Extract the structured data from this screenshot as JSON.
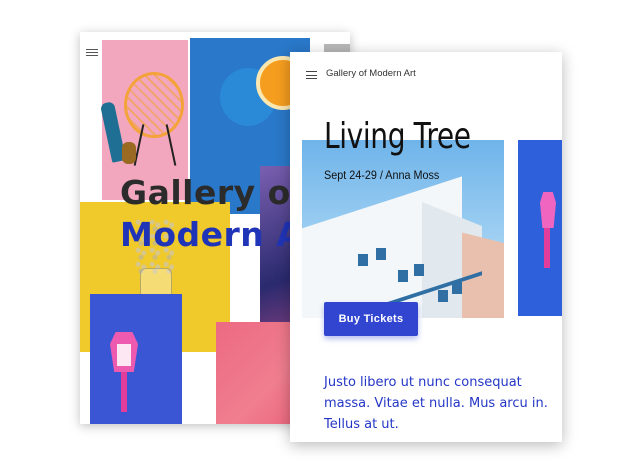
{
  "back_card": {
    "title_line1": "Gallery o",
    "title_line2": "Modern A",
    "menu_icon": "hamburger-menu-icon"
  },
  "front_card": {
    "brand": "Gallery of Modern Art",
    "menu_icon": "hamburger-menu-icon",
    "title": "Living Tree",
    "subtitle": "Sept 24-29 / Anna Moss",
    "cta_label": "Buy Tickets",
    "body": "Justo libero ut nunc consequat massa. Vitae et nulla. Mus arcu in. Tellus at ut."
  },
  "colors": {
    "accent_blue": "#3145d1",
    "title_blue": "#2034b8",
    "yellow": "#f0c92b",
    "pink": "#f2a7bf"
  }
}
